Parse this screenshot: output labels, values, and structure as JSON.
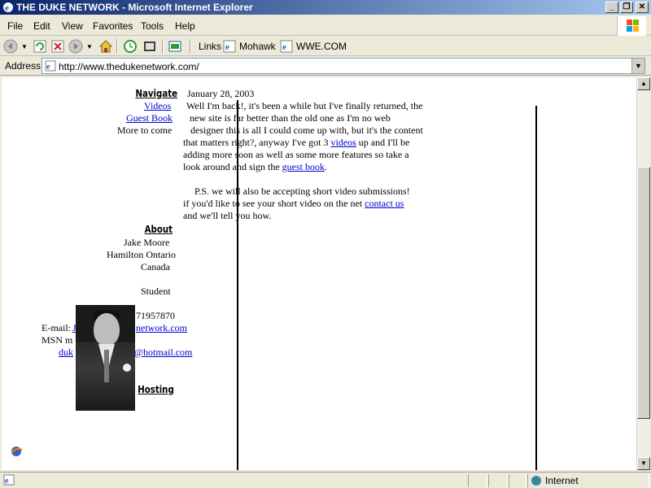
{
  "window": {
    "title": "THE DUKE NETWORK - Microsoft Internet Explorer",
    "minimize_glyph": "_",
    "maximize_glyph": "❐",
    "close_glyph": "✕"
  },
  "menu": {
    "items": [
      "File",
      "Edit",
      "View",
      "Favorites",
      "Tools",
      "Help"
    ]
  },
  "toolbar": {
    "links_label": "Links",
    "link1": "Mohawk",
    "link2": "WWE.COM"
  },
  "address": {
    "label": "Address",
    "url": "http://www.thedukenetwork.com/"
  },
  "sidebar": {
    "navigate_heading": "Navigate",
    "videos": "Videos",
    "guestbook": "Guest Book",
    "more": "More to come",
    "about_heading": "About",
    "name": "Jake Moore",
    "city": "Hamilton Ontario",
    "country": "Canada",
    "occupation": "Student",
    "phone_partial": "71957870",
    "email_label": "E-mail:",
    "email_partial_start": "J",
    "email_partial_end": "network.com",
    "msn_label": "MSN m",
    "msn_partial_start": "duk",
    "msn_partial_end": "@hotmail.com",
    "hosting_heading": "Hosting"
  },
  "post": {
    "date": "January 28, 2003",
    "line1": "Well I'm back!, it's been a while but I've finally returned, the",
    "line2": "new site is far better than the old one as I'm no web",
    "line3": "designer this is all I could come up with, but it's the content",
    "line4a": "that matters right?, anyway I've got 3 ",
    "line4_link": "videos",
    "line4b": " up and I'll be",
    "line5": "adding more soon as well as some more features so take a",
    "line6a": "look around and sign the ",
    "line6_link": "guest book",
    "line6b": ".",
    "ps1": "P.S. we will also be accepting short video submissions!",
    "ps2a": "if you'd like to see your short video on the net ",
    "ps2_link": "contact us",
    "ps3": "and we'll tell you how."
  },
  "status": {
    "zone": "Internet"
  },
  "colors": {
    "link": "#0000cc",
    "titlebar_start": "#0a246a",
    "titlebar_end": "#a6caf0"
  },
  "icons": [
    "ie-icon",
    "back-icon",
    "forward-icon",
    "stop-icon",
    "refresh-icon",
    "home-icon",
    "history-icon",
    "media-icon",
    "page-icon",
    "globe-icon"
  ]
}
